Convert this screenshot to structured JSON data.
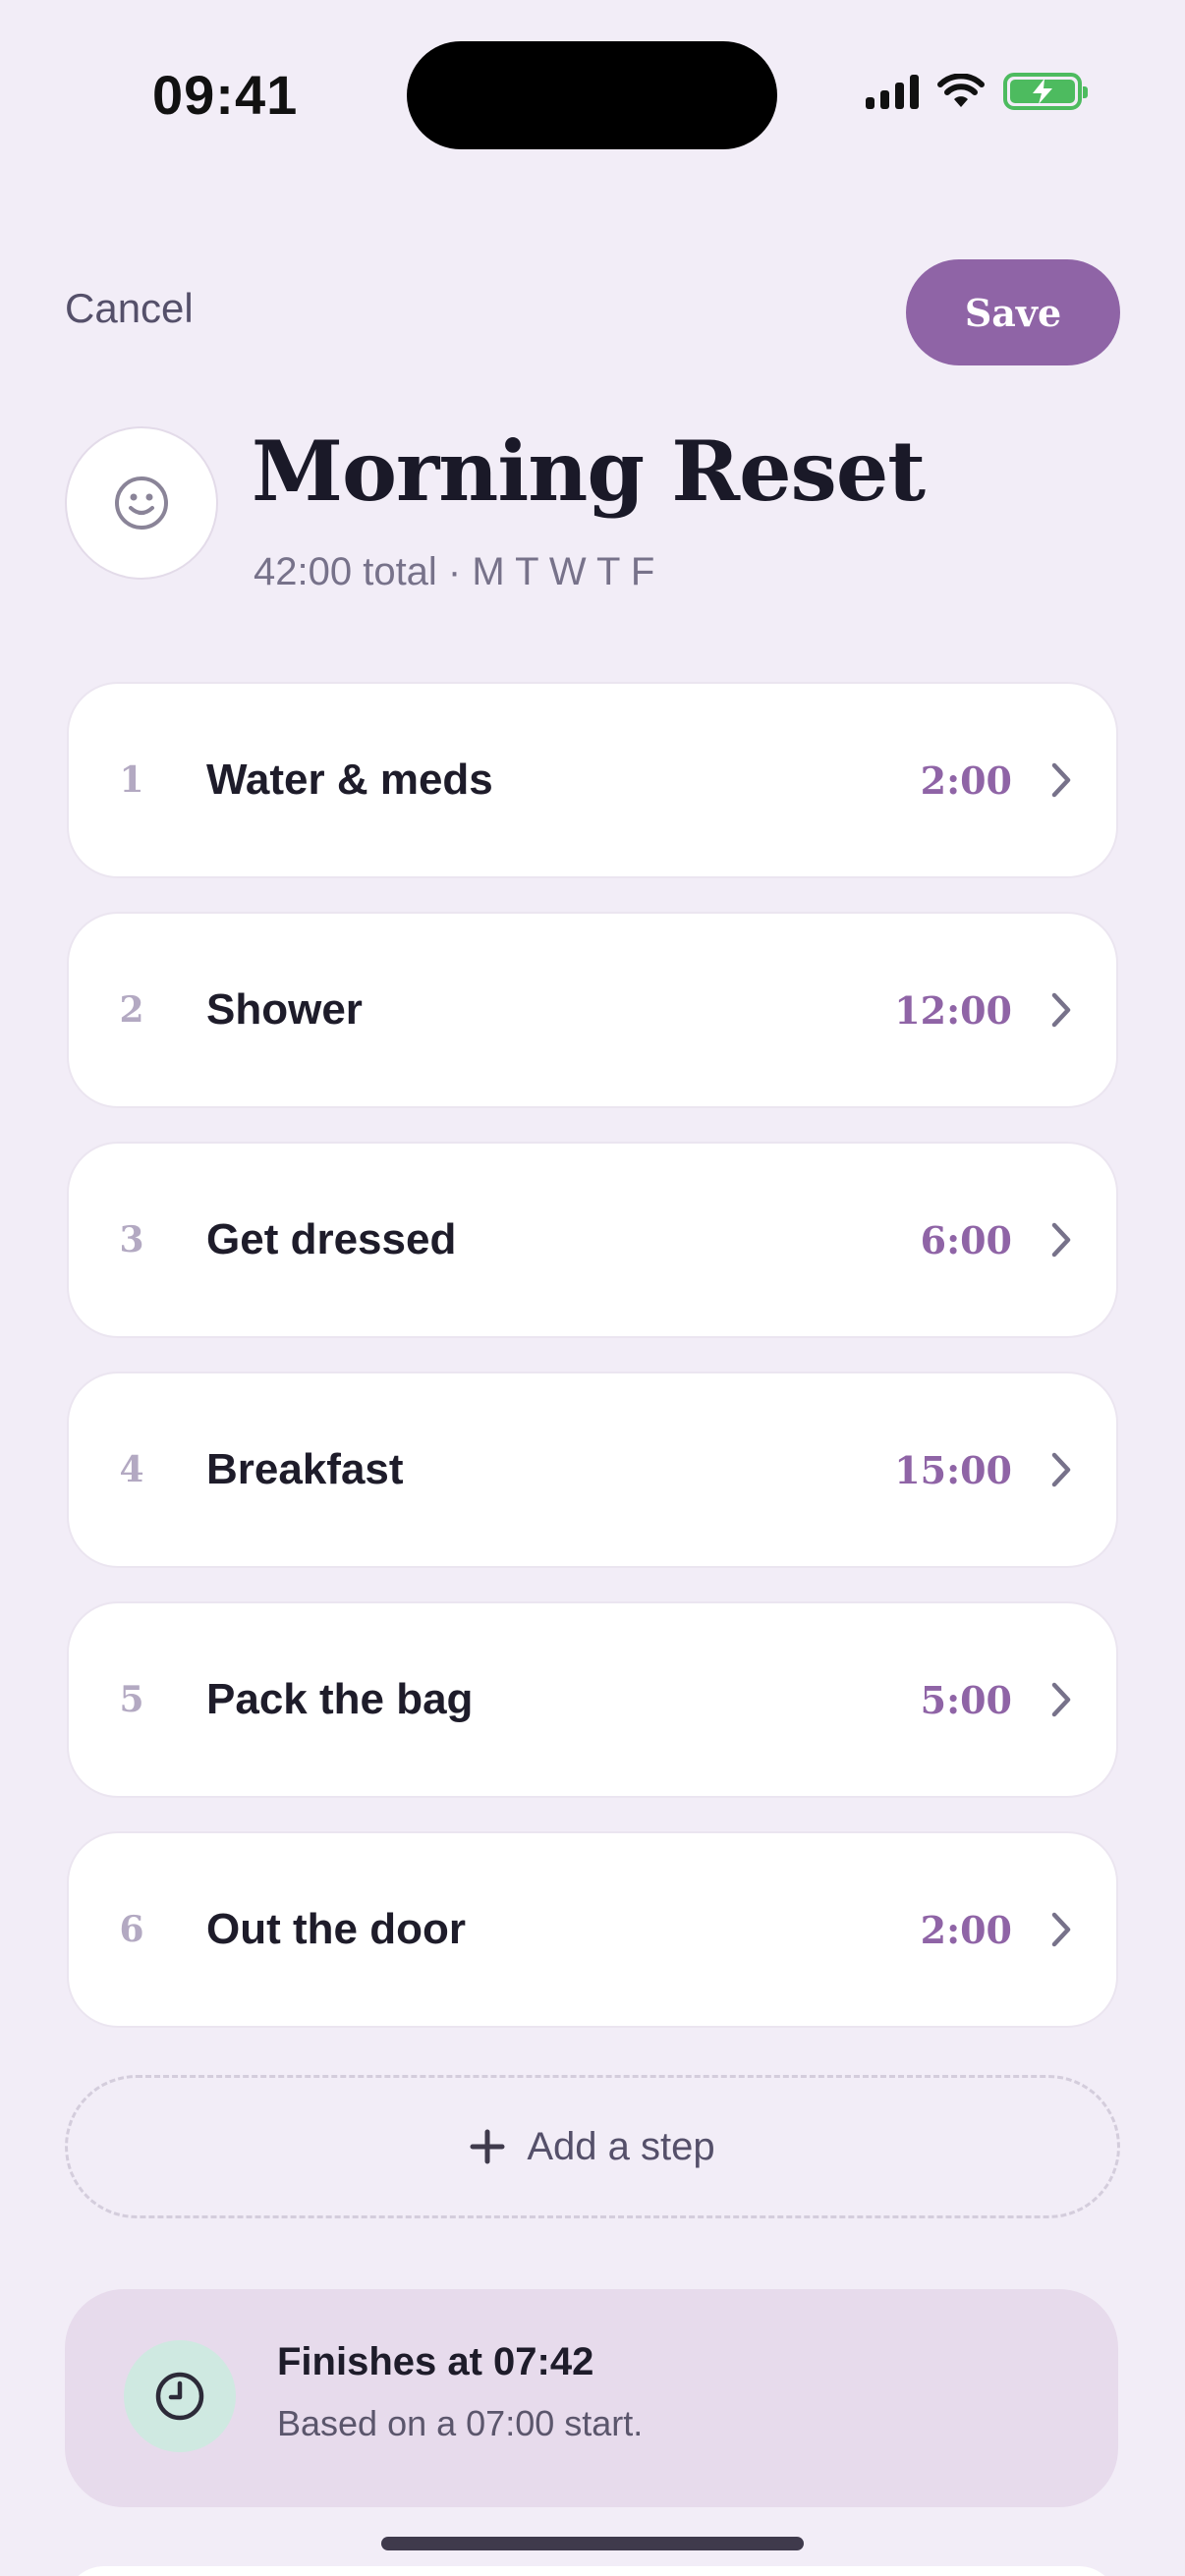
{
  "status_bar": {
    "time": "09:41"
  },
  "header": {
    "cancel_label": "Cancel",
    "save_label": "Save"
  },
  "routine": {
    "icon": "smiley-icon",
    "title": "Morning Reset",
    "subtitle": "42:00 total · M T W T F"
  },
  "steps": [
    {
      "number": "1",
      "name": "Water & meds",
      "duration": "2:00"
    },
    {
      "number": "2",
      "name": "Shower",
      "duration": "12:00"
    },
    {
      "number": "3",
      "name": "Get dressed",
      "duration": "6:00"
    },
    {
      "number": "4",
      "name": "Breakfast",
      "duration": "15:00"
    },
    {
      "number": "5",
      "name": "Pack the bag",
      "duration": "5:00"
    },
    {
      "number": "6",
      "name": "Out the door",
      "duration": "2:00"
    }
  ],
  "add_step": {
    "label": "Add a step",
    "icon": "plus-icon"
  },
  "finish": {
    "icon": "clock-icon",
    "title": "Finishes at 07:42",
    "subtitle": "Based on a 07:00 start."
  },
  "colors": {
    "background": "#f2edf7",
    "accent": "#8f64a6",
    "battery": "#4dbb5f",
    "finish_card": "#e7dbec",
    "clock_badge": "#cfe9e1"
  }
}
